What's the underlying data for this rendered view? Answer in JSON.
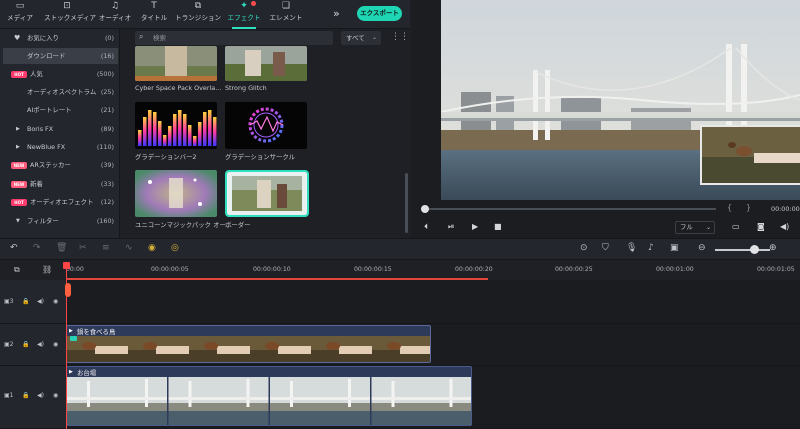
{
  "toolbar": {
    "tabs": [
      {
        "label": "メディア",
        "icon": "folder-icon"
      },
      {
        "label": "ストックメディア",
        "icon": "stock-media-icon"
      },
      {
        "label": "オーディオ",
        "icon": "music-note-icon"
      },
      {
        "label": "タイトル",
        "icon": "title-t-icon"
      },
      {
        "label": "トランジション",
        "icon": "transition-icon"
      },
      {
        "label": "エフェクト",
        "icon": "effects-sparkle-icon"
      },
      {
        "label": "エレメント",
        "icon": "elements-icon"
      }
    ],
    "active_tab": "エフェクト",
    "export_label": "エクスポート"
  },
  "categories": [
    {
      "name": "お気に入り",
      "count": "(0)",
      "icon": "heart-icon"
    },
    {
      "name": "ダウンロード",
      "count": "(16)",
      "active": true
    },
    {
      "name": "人気",
      "count": "(500)",
      "badge": "HOT"
    },
    {
      "name": "オーディオスペクトラム",
      "count": "(25)"
    },
    {
      "name": "AIポートレート",
      "count": "(21)"
    },
    {
      "name": "Boris FX",
      "count": "(89)",
      "arrow": "▶"
    },
    {
      "name": "NewBlue FX",
      "count": "(110)",
      "arrow": "▶"
    },
    {
      "name": "ARステッカー",
      "count": "(39)",
      "badge": "NEW"
    },
    {
      "name": "新着",
      "count": "(33)",
      "badge": "NEW"
    },
    {
      "name": "オーディオエフェクト",
      "count": "(12)",
      "badge": "HOT"
    },
    {
      "name": "フィルター",
      "count": "(160)",
      "arrow": "▼"
    }
  ],
  "effects": {
    "search_placeholder": "検索",
    "filter_value": "すべて",
    "items": [
      {
        "label": "Cyber Space Pack Overla..."
      },
      {
        "label": "Strong Glitch"
      },
      {
        "label": "グラデーションバー2"
      },
      {
        "label": "グラデーションサークル"
      },
      {
        "label": "ユニコーンマジックパック オー..."
      },
      {
        "label": "ボーダー",
        "selected": true
      }
    ]
  },
  "preview": {
    "time": "00:00:00",
    "quality": "フル"
  },
  "timeline": {
    "ruler": [
      "00:00",
      "00:00:00:05",
      "00:00:00:10",
      "00:00:00:15",
      "00:00:00:20",
      "00:00:01:00",
      "00:00:01:05"
    ],
    "ruler_extra": "00:00:00:25",
    "tracks": [
      {
        "label": "3"
      },
      {
        "label": "2",
        "clip_label": "鍋を食べる鳥"
      },
      {
        "label": "1",
        "clip_label": "お台場"
      }
    ]
  },
  "colors": {
    "accent": "#2fe0c0",
    "playhead": "#ff4545",
    "export": "#1fd6b4"
  }
}
